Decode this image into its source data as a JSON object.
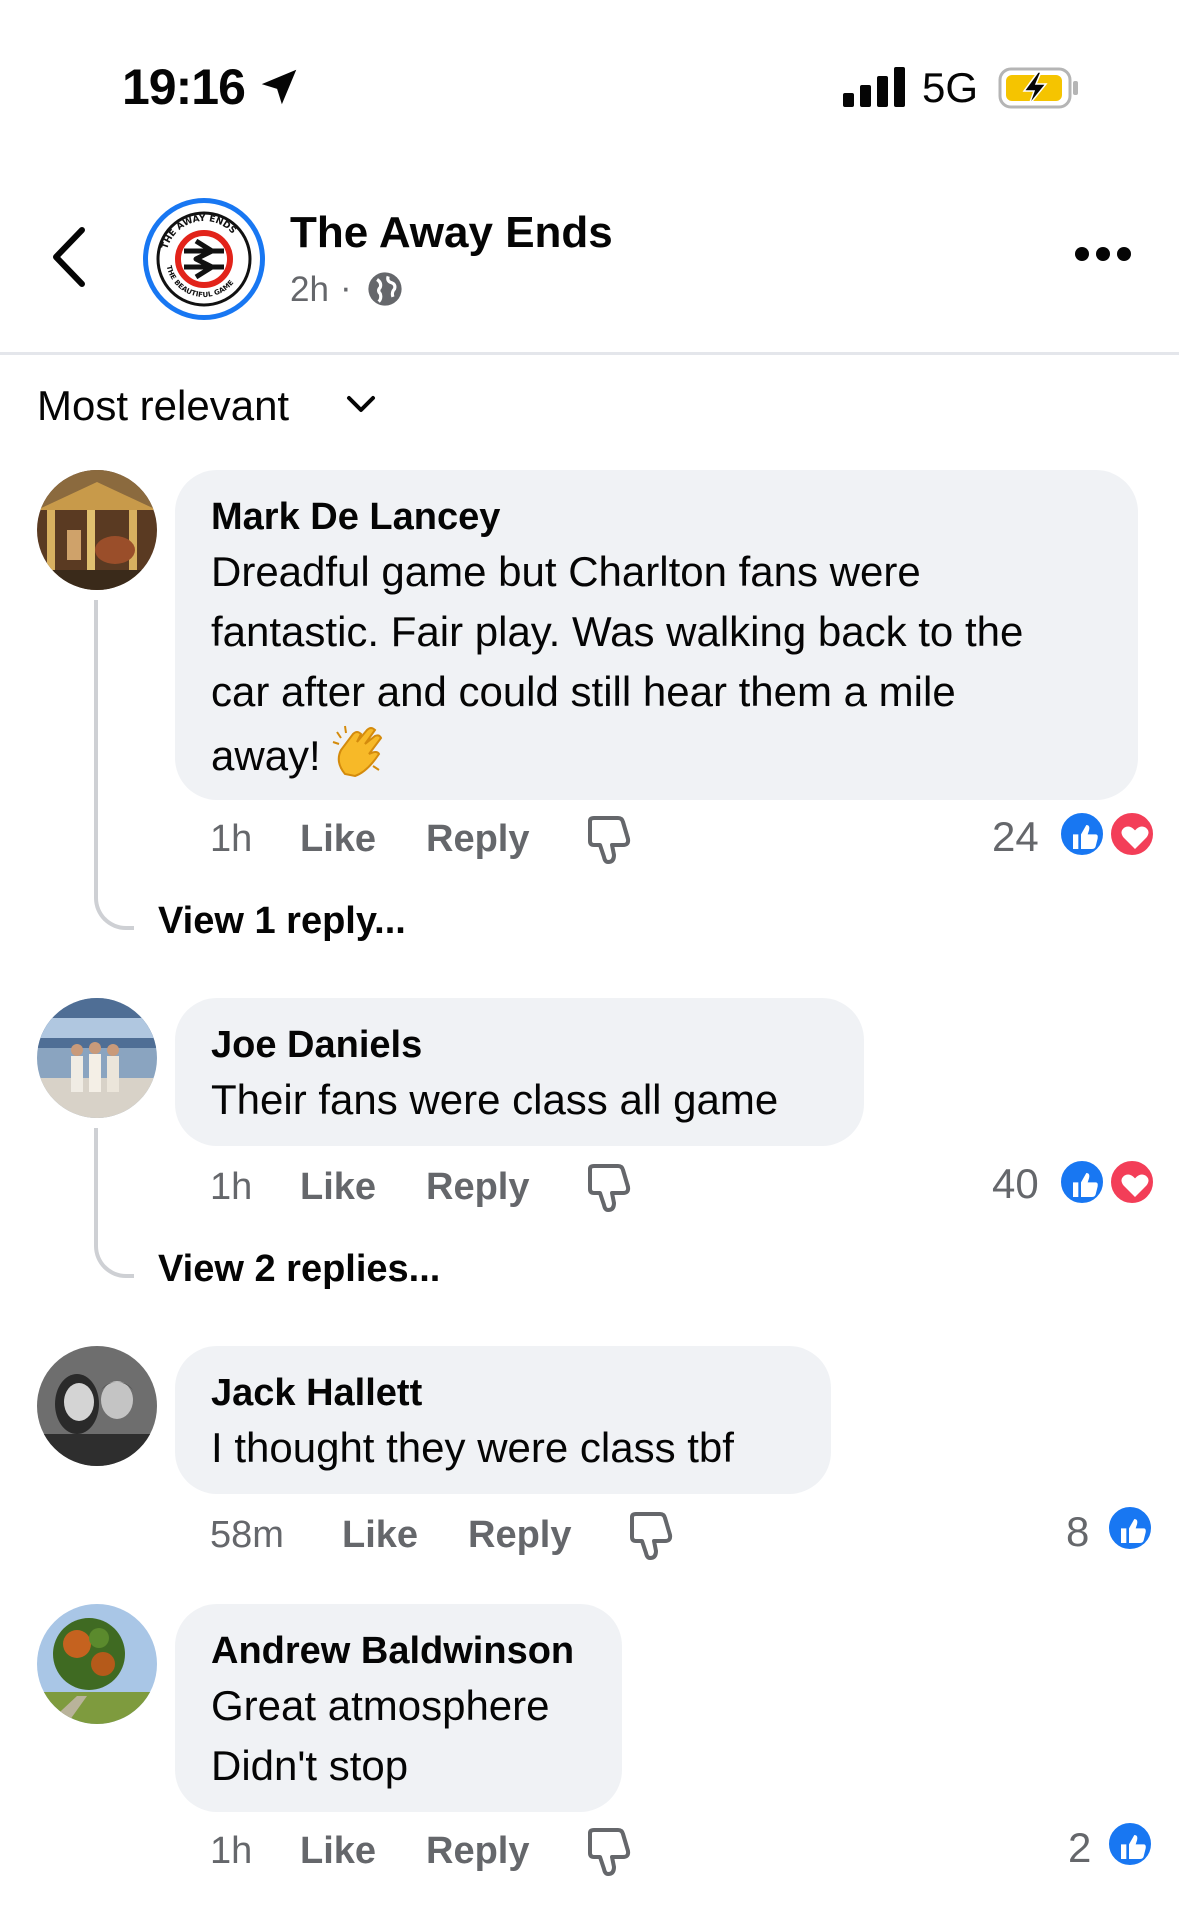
{
  "status_bar": {
    "time": "19:16",
    "network": "5G",
    "icons": [
      "location-arrow-icon",
      "signal-bars-icon",
      "battery-charging-icon"
    ]
  },
  "header": {
    "page_name": "The Away Ends",
    "post_age": "2h",
    "separator": "·",
    "privacy_icon": "globe-icon",
    "avatar_ring_text_top": "THE AWAY ENDS",
    "avatar_ring_text_bottom": "THE BEAUTIFUL GAME",
    "accent_color": "#1877f2"
  },
  "sort": {
    "label": "Most relevant"
  },
  "comments": [
    {
      "author": "Mark De Lancey",
      "text": "Dreadful game but Charlton fans were\nfantastic. Fair play. Was walking back to the\ncar after and could still hear them a mile\naway!",
      "emoji": "clapping-hands",
      "time": "1h",
      "like_label": "Like",
      "reply_label": "Reply",
      "reaction_count": "24",
      "reactions": [
        "like",
        "love"
      ],
      "view_replies": "View 1 reply..."
    },
    {
      "author": "Joe Daniels",
      "text": "Their fans were class all game",
      "time": "1h",
      "like_label": "Like",
      "reply_label": "Reply",
      "reaction_count": "40",
      "reactions": [
        "like",
        "love"
      ],
      "view_replies": "View 2 replies..."
    },
    {
      "author": "Jack Hallett",
      "text": "I thought they were class tbf",
      "time": "58m",
      "like_label": "Like",
      "reply_label": "Reply",
      "reaction_count": "8",
      "reactions": [
        "like"
      ]
    },
    {
      "author": "Andrew Baldwinson",
      "text": "Great atmosphere\nDidn't stop",
      "time": "1h",
      "like_label": "Like",
      "reply_label": "Reply",
      "reaction_count": "2",
      "reactions": [
        "like"
      ]
    }
  ],
  "colors": {
    "like_blue": "#1877f2",
    "love_red": "#f33e58",
    "bubble_bg": "#f0f2f5",
    "secondary_text": "#65676b"
  }
}
